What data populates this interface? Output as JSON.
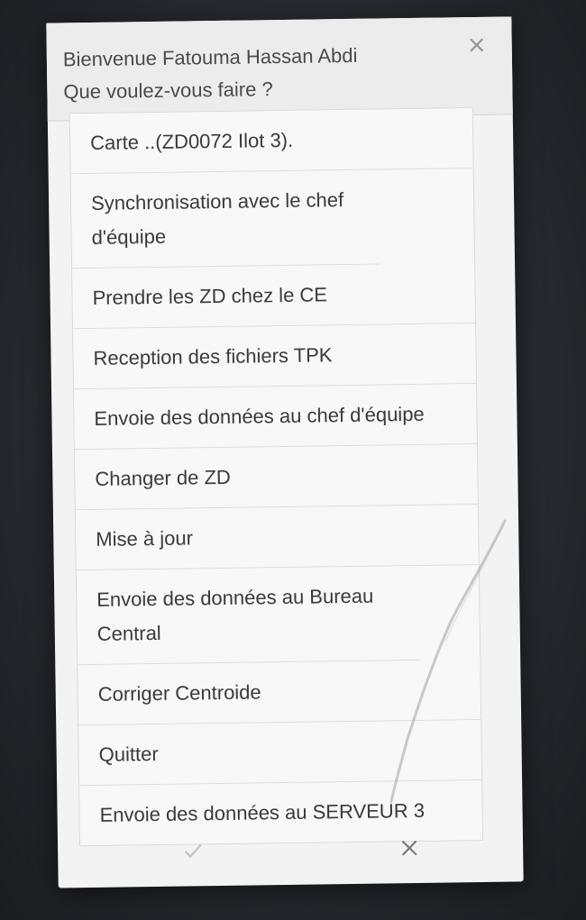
{
  "dialog": {
    "welcome": "Bienvenue Fatouma Hassan Abdi",
    "question": "Que voulez-vous faire ?",
    "close_icon": "close-icon"
  },
  "menu": {
    "items": [
      {
        "label": "Carte ..(ZD0072 Ilot 3)."
      },
      {
        "label": "Synchronisation avec le chef d'équipe"
      },
      {
        "label": "Prendre les ZD chez le CE"
      },
      {
        "label": "Reception des fichiers TPK"
      },
      {
        "label": "Envoie des données au chef d'équipe"
      },
      {
        "label": "Changer de ZD"
      },
      {
        "label": "Mise à jour"
      },
      {
        "label": "Envoie des données au Bureau Central"
      },
      {
        "label": "Corriger Centroide"
      },
      {
        "label": "Quitter"
      },
      {
        "label": "Envoie des données au SERVEUR 3"
      }
    ]
  },
  "footer": {
    "confirm_icon": "checkmark-icon",
    "cancel_icon": "close-icon"
  },
  "colors": {
    "dialog_bg": "#f3f3f3",
    "text": "#3a3a3a",
    "divider": "#dcdcdc"
  }
}
